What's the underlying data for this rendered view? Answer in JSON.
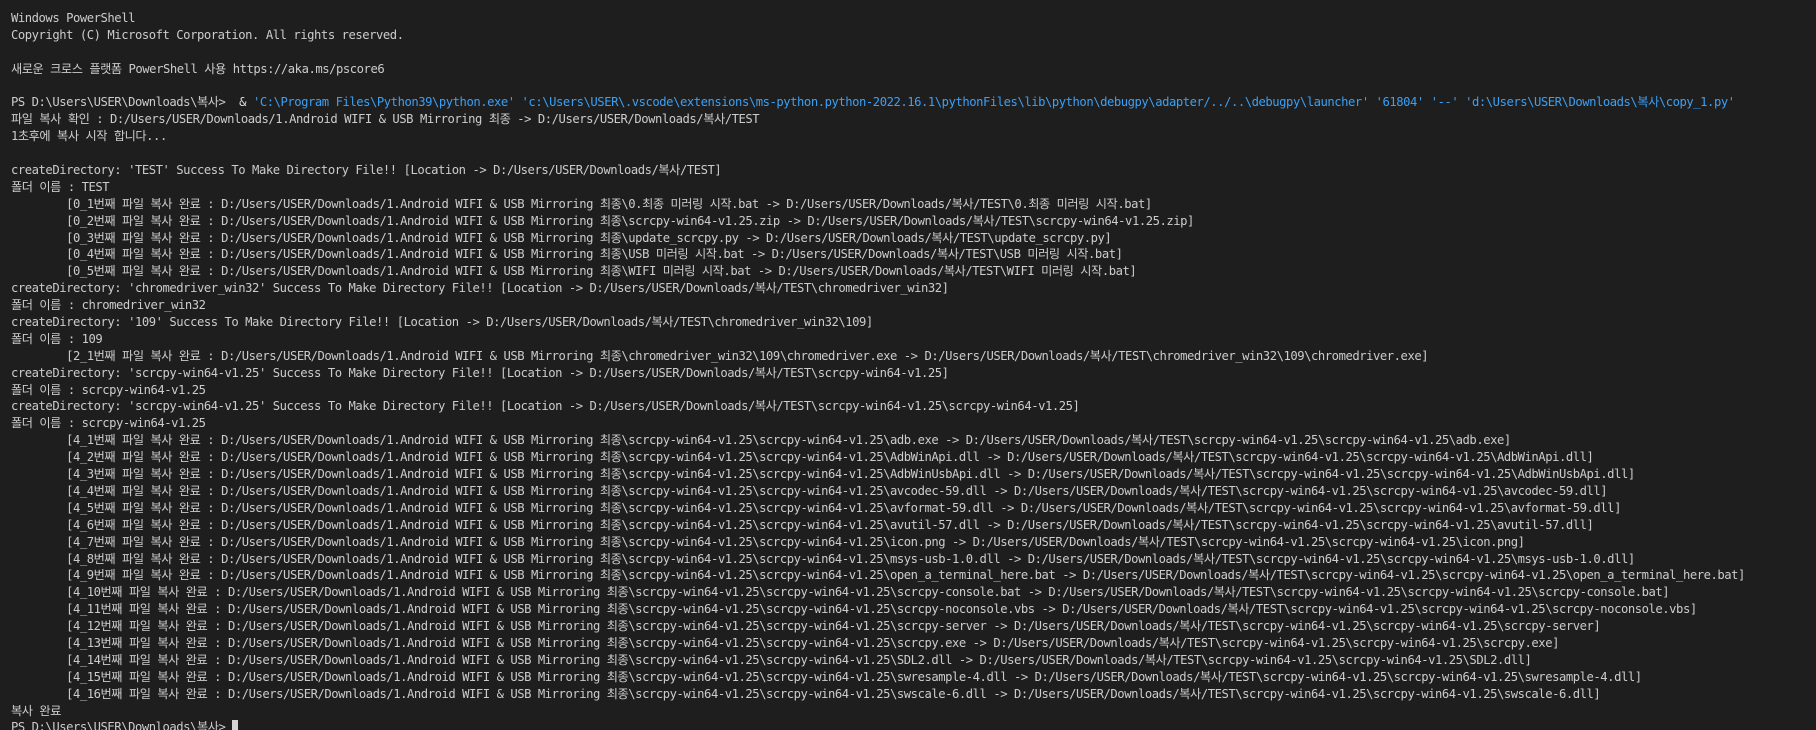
{
  "app": {
    "title": "Windows PowerShell"
  },
  "terminal": {
    "header": [
      "Windows PowerShell",
      "Copyright (C) Microsoft Corporation. All rights reserved.",
      "",
      "새로운 크로스 플랫폼 PowerShell 사용 https://aka.ms/pscore6",
      ""
    ],
    "command": {
      "prompt": "PS D:\\Users\\USER\\Downloads\\복사> ",
      "operator": " & ",
      "args": "'C:\\Program Files\\Python39\\python.exe' 'c:\\Users\\USER\\.vscode\\extensions\\ms-python.python-2022.16.1\\pythonFiles\\lib\\python\\debugpy\\adapter/../..\\debugpy\\launcher' '61804' '--' 'd:\\Users\\USER\\Downloads\\복사\\copy_1.py'"
    },
    "output": [
      "파일 복사 확인 : D:/Users/USER/Downloads/1.Android WIFI & USB Mirroring 최종 -> D:/Users/USER/Downloads/복사/TEST",
      "1초후에 복사 시작 합니다...",
      "",
      "createDirectory: 'TEST' Success To Make Directory File!! [Location -> D:/Users/USER/Downloads/복사/TEST]",
      "폴더 이름 : TEST",
      "        [0_1번째 파일 복사 완료 : D:/Users/USER/Downloads/1.Android WIFI & USB Mirroring 최종\\0.최종 미러링 시작.bat -> D:/Users/USER/Downloads/복사/TEST\\0.최종 미러링 시작.bat]",
      "        [0_2번째 파일 복사 완료 : D:/Users/USER/Downloads/1.Android WIFI & USB Mirroring 최종\\scrcpy-win64-v1.25.zip -> D:/Users/USER/Downloads/복사/TEST\\scrcpy-win64-v1.25.zip]",
      "        [0_3번째 파일 복사 완료 : D:/Users/USER/Downloads/1.Android WIFI & USB Mirroring 최종\\update_scrcpy.py -> D:/Users/USER/Downloads/복사/TEST\\update_scrcpy.py]",
      "        [0_4번째 파일 복사 완료 : D:/Users/USER/Downloads/1.Android WIFI & USB Mirroring 최종\\USB 미러링 시작.bat -> D:/Users/USER/Downloads/복사/TEST\\USB 미러링 시작.bat]",
      "        [0_5번째 파일 복사 완료 : D:/Users/USER/Downloads/1.Android WIFI & USB Mirroring 최종\\WIFI 미러링 시작.bat -> D:/Users/USER/Downloads/복사/TEST\\WIFI 미러링 시작.bat]",
      "createDirectory: 'chromedriver_win32' Success To Make Directory File!! [Location -> D:/Users/USER/Downloads/복사/TEST\\chromedriver_win32]",
      "폴더 이름 : chromedriver_win32",
      "createDirectory: '109' Success To Make Directory File!! [Location -> D:/Users/USER/Downloads/복사/TEST\\chromedriver_win32\\109]",
      "폴더 이름 : 109",
      "        [2_1번째 파일 복사 완료 : D:/Users/USER/Downloads/1.Android WIFI & USB Mirroring 최종\\chromedriver_win32\\109\\chromedriver.exe -> D:/Users/USER/Downloads/복사/TEST\\chromedriver_win32\\109\\chromedriver.exe]",
      "createDirectory: 'scrcpy-win64-v1.25' Success To Make Directory File!! [Location -> D:/Users/USER/Downloads/복사/TEST\\scrcpy-win64-v1.25]",
      "폴더 이름 : scrcpy-win64-v1.25",
      "createDirectory: 'scrcpy-win64-v1.25' Success To Make Directory File!! [Location -> D:/Users/USER/Downloads/복사/TEST\\scrcpy-win64-v1.25\\scrcpy-win64-v1.25]",
      "폴더 이름 : scrcpy-win64-v1.25",
      "        [4_1번째 파일 복사 완료 : D:/Users/USER/Downloads/1.Android WIFI & USB Mirroring 최종\\scrcpy-win64-v1.25\\scrcpy-win64-v1.25\\adb.exe -> D:/Users/USER/Downloads/복사/TEST\\scrcpy-win64-v1.25\\scrcpy-win64-v1.25\\adb.exe]",
      "        [4_2번째 파일 복사 완료 : D:/Users/USER/Downloads/1.Android WIFI & USB Mirroring 최종\\scrcpy-win64-v1.25\\scrcpy-win64-v1.25\\AdbWinApi.dll -> D:/Users/USER/Downloads/복사/TEST\\scrcpy-win64-v1.25\\scrcpy-win64-v1.25\\AdbWinApi.dll]",
      "        [4_3번째 파일 복사 완료 : D:/Users/USER/Downloads/1.Android WIFI & USB Mirroring 최종\\scrcpy-win64-v1.25\\scrcpy-win64-v1.25\\AdbWinUsbApi.dll -> D:/Users/USER/Downloads/복사/TEST\\scrcpy-win64-v1.25\\scrcpy-win64-v1.25\\AdbWinUsbApi.dll]",
      "        [4_4번째 파일 복사 완료 : D:/Users/USER/Downloads/1.Android WIFI & USB Mirroring 최종\\scrcpy-win64-v1.25\\scrcpy-win64-v1.25\\avcodec-59.dll -> D:/Users/USER/Downloads/복사/TEST\\scrcpy-win64-v1.25\\scrcpy-win64-v1.25\\avcodec-59.dll]",
      "        [4_5번째 파일 복사 완료 : D:/Users/USER/Downloads/1.Android WIFI & USB Mirroring 최종\\scrcpy-win64-v1.25\\scrcpy-win64-v1.25\\avformat-59.dll -> D:/Users/USER/Downloads/복사/TEST\\scrcpy-win64-v1.25\\scrcpy-win64-v1.25\\avformat-59.dll]",
      "        [4_6번째 파일 복사 완료 : D:/Users/USER/Downloads/1.Android WIFI & USB Mirroring 최종\\scrcpy-win64-v1.25\\scrcpy-win64-v1.25\\avutil-57.dll -> D:/Users/USER/Downloads/복사/TEST\\scrcpy-win64-v1.25\\scrcpy-win64-v1.25\\avutil-57.dll]",
      "        [4_7번째 파일 복사 완료 : D:/Users/USER/Downloads/1.Android WIFI & USB Mirroring 최종\\scrcpy-win64-v1.25\\scrcpy-win64-v1.25\\icon.png -> D:/Users/USER/Downloads/복사/TEST\\scrcpy-win64-v1.25\\scrcpy-win64-v1.25\\icon.png]",
      "        [4_8번째 파일 복사 완료 : D:/Users/USER/Downloads/1.Android WIFI & USB Mirroring 최종\\scrcpy-win64-v1.25\\scrcpy-win64-v1.25\\msys-usb-1.0.dll -> D:/Users/USER/Downloads/복사/TEST\\scrcpy-win64-v1.25\\scrcpy-win64-v1.25\\msys-usb-1.0.dll]",
      "        [4_9번째 파일 복사 완료 : D:/Users/USER/Downloads/1.Android WIFI & USB Mirroring 최종\\scrcpy-win64-v1.25\\scrcpy-win64-v1.25\\open_a_terminal_here.bat -> D:/Users/USER/Downloads/복사/TEST\\scrcpy-win64-v1.25\\scrcpy-win64-v1.25\\open_a_terminal_here.bat]",
      "        [4_10번째 파일 복사 완료 : D:/Users/USER/Downloads/1.Android WIFI & USB Mirroring 최종\\scrcpy-win64-v1.25\\scrcpy-win64-v1.25\\scrcpy-console.bat -> D:/Users/USER/Downloads/복사/TEST\\scrcpy-win64-v1.25\\scrcpy-win64-v1.25\\scrcpy-console.bat]",
      "        [4_11번째 파일 복사 완료 : D:/Users/USER/Downloads/1.Android WIFI & USB Mirroring 최종\\scrcpy-win64-v1.25\\scrcpy-win64-v1.25\\scrcpy-noconsole.vbs -> D:/Users/USER/Downloads/복사/TEST\\scrcpy-win64-v1.25\\scrcpy-win64-v1.25\\scrcpy-noconsole.vbs]",
      "        [4_12번째 파일 복사 완료 : D:/Users/USER/Downloads/1.Android WIFI & USB Mirroring 최종\\scrcpy-win64-v1.25\\scrcpy-win64-v1.25\\scrcpy-server -> D:/Users/USER/Downloads/복사/TEST\\scrcpy-win64-v1.25\\scrcpy-win64-v1.25\\scrcpy-server]",
      "        [4_13번째 파일 복사 완료 : D:/Users/USER/Downloads/1.Android WIFI & USB Mirroring 최종\\scrcpy-win64-v1.25\\scrcpy-win64-v1.25\\scrcpy.exe -> D:/Users/USER/Downloads/복사/TEST\\scrcpy-win64-v1.25\\scrcpy-win64-v1.25\\scrcpy.exe]",
      "        [4_14번째 파일 복사 완료 : D:/Users/USER/Downloads/1.Android WIFI & USB Mirroring 최종\\scrcpy-win64-v1.25\\scrcpy-win64-v1.25\\SDL2.dll -> D:/Users/USER/Downloads/복사/TEST\\scrcpy-win64-v1.25\\scrcpy-win64-v1.25\\SDL2.dll]",
      "        [4_15번째 파일 복사 완료 : D:/Users/USER/Downloads/1.Android WIFI & USB Mirroring 최종\\scrcpy-win64-v1.25\\scrcpy-win64-v1.25\\swresample-4.dll -> D:/Users/USER/Downloads/복사/TEST\\scrcpy-win64-v1.25\\scrcpy-win64-v1.25\\swresample-4.dll]",
      "        [4_16번째 파일 복사 완료 : D:/Users/USER/Downloads/1.Android WIFI & USB Mirroring 최종\\scrcpy-win64-v1.25\\scrcpy-win64-v1.25\\swscale-6.dll -> D:/Users/USER/Downloads/복사/TEST\\scrcpy-win64-v1.25\\scrcpy-win64-v1.25\\swscale-6.dll]",
      "복사 완료"
    ],
    "final_prompt": "PS D:\\Users\\USER\\Downloads\\복사> ",
    "colors": {
      "background": "#1e1e1e",
      "text": "#cccccc",
      "command_args": "#3ba0f5"
    }
  }
}
